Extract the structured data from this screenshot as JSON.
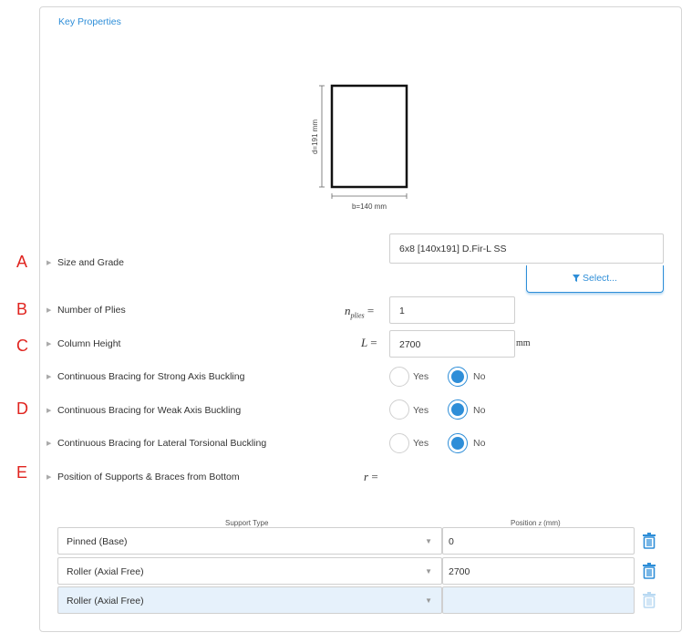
{
  "callouts": [
    "A",
    "B",
    "C",
    "D",
    "E"
  ],
  "panel": {
    "title": "Key Properties"
  },
  "diagram": {
    "depth_label": "d=191 mm",
    "width_label": "b=140 mm"
  },
  "fields": {
    "size_grade": {
      "label": "Size and Grade",
      "value": "6x8 [140x191] D.Fir-L SS",
      "button_label": "Select...",
      "button_icon": "filter-icon"
    },
    "plies": {
      "label": "Number of Plies",
      "symbol": "n",
      "subscript": "plies",
      "eq": "=",
      "value": "1"
    },
    "height": {
      "label": "Column Height",
      "symbol": "L",
      "eq": "=",
      "value": "2700",
      "unit": "mm"
    },
    "strong_axis": {
      "label": "Continuous Bracing for Strong Axis Buckling",
      "yes": "Yes",
      "no": "No",
      "selected": "No"
    },
    "weak_axis": {
      "label": "Continuous Bracing for Weak Axis Buckling",
      "yes": "Yes",
      "no": "No",
      "selected": "No"
    },
    "lateral_torsional": {
      "label": "Continuous Bracing for Lateral Torsional Buckling",
      "yes": "Yes",
      "no": "No",
      "selected": "No"
    },
    "supports": {
      "label": "Position of Supports & Braces from Bottom",
      "symbol": "r",
      "eq": "="
    }
  },
  "supports_table": {
    "col_type": "Support Type",
    "col_position": "Position",
    "col_position_sym": "z",
    "col_position_unit": "(mm)",
    "rows": [
      {
        "type": "Pinned (Base)",
        "position": "0"
      },
      {
        "type": "Roller (Axial Free)",
        "position": "2700"
      },
      {
        "type": "Roller (Axial Free)",
        "position": ""
      }
    ]
  },
  "colors": {
    "accent": "#2e8ed8",
    "callout": "#e0241f",
    "new_row_bg": "#e6f1fb"
  }
}
